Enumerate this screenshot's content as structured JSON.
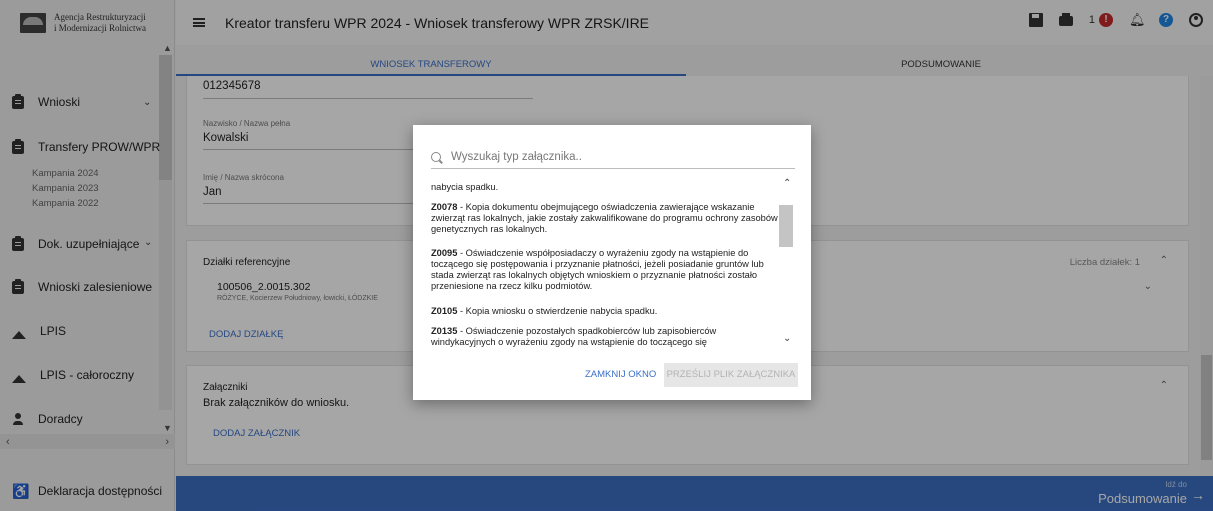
{
  "sidebar": {
    "logo_line1": "Agencja Restrukturyzacji",
    "logo_line2": "i Modernizacji Rolnictwa",
    "items": [
      {
        "label": "Wnioski"
      },
      {
        "label": "Transfery PROW/WPR"
      },
      {
        "label": "Dok. uzupełniające"
      },
      {
        "label": "Wnioski zalesieniowe"
      },
      {
        "label": "LPIS"
      },
      {
        "label": "LPIS - całoroczny"
      },
      {
        "label": "Doradcy"
      },
      {
        "label": "Deklaracja dostępności"
      }
    ],
    "sub_items": [
      "Kampania 2024",
      "Kampania 2023",
      "Kampania 2022"
    ]
  },
  "header": {
    "title": "Kreator transferu WPR 2024 - Wniosek transferowy WPR ZRSK/IRE",
    "notification_count": "1",
    "alert_mark": "!",
    "help_mark": "?"
  },
  "tabs": [
    "WNIOSEK TRANSFEROWY",
    "PODSUMOWANIE"
  ],
  "form": {
    "id_value": "012345678",
    "surname_label": "Nazwisko / Nazwa pełna",
    "surname_value": "Kowalski",
    "firstname_label": "Imię / Nazwa skrócona",
    "firstname_value": "Jan"
  },
  "plots": {
    "title": "Działki referencyjne",
    "count_label": "Liczba działek: 1",
    "plot_id": "100506_2.0015.302",
    "plot_location": "RÓŻYCE, Kocierzew Południowy, łowicki, ŁÓDZKIE",
    "add_link": "DODAJ DZIAŁKĘ"
  },
  "attachments": {
    "title": "Załączniki",
    "empty_text": "Brak załączników do wniosku.",
    "add_link": "DODAJ ZAŁĄCZNIK"
  },
  "footer": {
    "small": "Idź do",
    "big": "Podsumowanie"
  },
  "modal": {
    "search_placeholder": "Wyszukaj typ załącznika..",
    "items": [
      {
        "code": "",
        "text": "nabycia spadku."
      },
      {
        "code": "Z0078",
        "text": " - Kopia dokumentu obejmującego oświadczenia zawierające wskazanie zwierząt ras lokalnych, jakie zostały zakwalifikowane do programu ochrony zasobów genetycznych ras lokalnych."
      },
      {
        "code": "Z0095",
        "text": " - Oświadczenie współposiadaczy o wyrażeniu zgody na wstąpienie do toczącego się postępowania i przyznanie płatności, jeżeli posiadanie gruntów lub stada zwierząt ras lokalnych objętych wnioskiem o przyznanie płatności zostało przeniesione na rzecz kilku podmiotów."
      },
      {
        "code": "Z0105",
        "text": " - Kopia wniosku o stwierdzenie nabycia spadku."
      },
      {
        "code": "Z0135",
        "text": " - Oświadczenie pozostałych spadkobierców lub zapisobierców windykacyjnych o wyrażeniu zgody na wstąpienie do toczącego się"
      }
    ],
    "close_label": "ZAMKNIJ OKNO",
    "upload_label": "PRZEŚLIJ PLIK ZAŁĄCZNIKA"
  },
  "colors": {
    "accent": "#3a6fc9",
    "footer": "#3c6fc4",
    "alert": "#c62828",
    "help": "#1e88e5"
  }
}
